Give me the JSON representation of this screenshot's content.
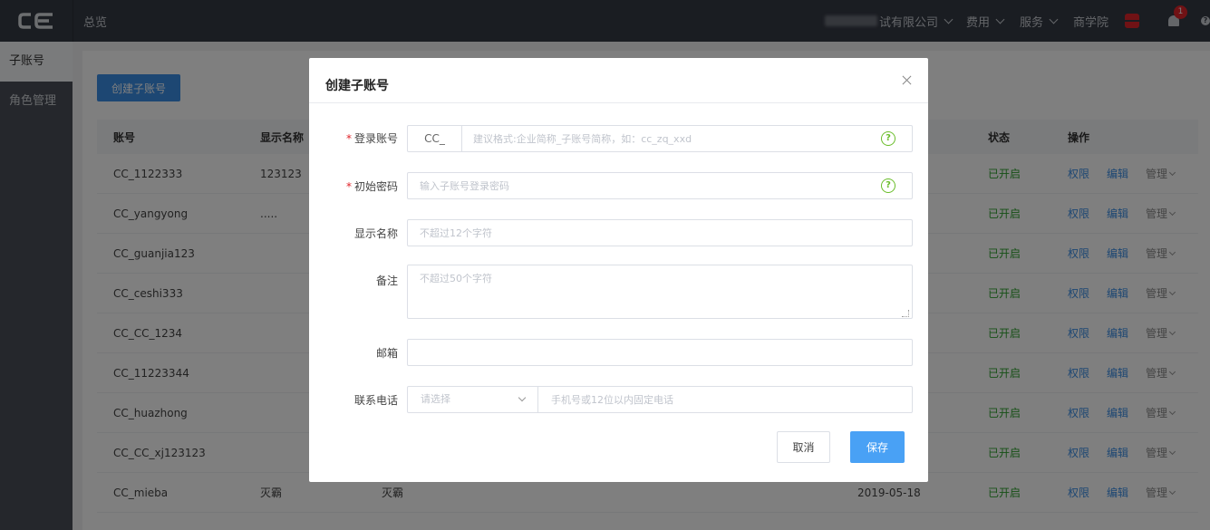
{
  "topbar": {
    "logo_text": "CE",
    "nav_overview": "总览",
    "company_suffix": "试有限公司",
    "menus": [
      {
        "label": "费用"
      },
      {
        "label": "服务"
      }
    ],
    "academy": "商学院",
    "notification_count": "1",
    "help_glyph": "?"
  },
  "sidebar": {
    "items": [
      {
        "label": "子账号"
      },
      {
        "label": "角色管理"
      }
    ]
  },
  "main": {
    "create_button": "创建子账号",
    "table": {
      "headers": {
        "account": "账号",
        "display_name": "显示名称",
        "status": "状态",
        "ops": "操作"
      },
      "rows": [
        {
          "account": "CC_1122333",
          "display_name": "123123",
          "alias": "",
          "date": "",
          "status": "已开启"
        },
        {
          "account": "CC_yangyong",
          "display_name": ".....",
          "alias": "",
          "date": "",
          "status": "已开启"
        },
        {
          "account": "CC_guanjia123",
          "display_name": "",
          "alias": "",
          "date": "",
          "status": "已开启"
        },
        {
          "account": "CC_ceshi333",
          "display_name": "",
          "alias": "",
          "date": "",
          "status": "已开启"
        },
        {
          "account": "CC_CC_1234",
          "display_name": "",
          "alias": "",
          "date": "",
          "status": "已开启"
        },
        {
          "account": "CC_11223344",
          "display_name": "",
          "alias": "",
          "date": "",
          "status": "已开启"
        },
        {
          "account": "CC_huazhong",
          "display_name": "",
          "alias": "",
          "date": "",
          "status": "已开启"
        },
        {
          "account": "CC_CC_xj123123",
          "display_name": "",
          "alias": "",
          "date": "",
          "status": "已开启"
        },
        {
          "account": "CC_mieba",
          "display_name": "灭霸",
          "alias": "灭霸",
          "date": "2019-05-18",
          "status": "已开启"
        }
      ],
      "op_permission": "权限",
      "op_edit": "编辑",
      "op_manage": "管理"
    }
  },
  "modal": {
    "title": "创建子账号",
    "fields": {
      "login_account": {
        "label": "登录账号",
        "prefix": "CC_",
        "placeholder": "建议格式:企业简称_子账号简称，如：cc_zq_xxd"
      },
      "initial_password": {
        "label": "初始密码",
        "placeholder": "输入子账号登录密码"
      },
      "display_name": {
        "label": "显示名称",
        "placeholder": "不超过12个字符"
      },
      "remark": {
        "label": "备注",
        "placeholder": "不超过50个字符"
      },
      "email": {
        "label": "邮箱",
        "placeholder": ""
      },
      "phone": {
        "label": "联系电话",
        "select_placeholder": "请选择",
        "placeholder": "手机号或12位以内固定电话"
      }
    },
    "required_mark": "*",
    "help_glyph": "?",
    "cancel_label": "取消",
    "save_label": "保存"
  },
  "colors": {
    "topbar_bg": "#353a45",
    "sidebar_bg": "#4a4f58",
    "primary": "#49a1f5",
    "status_green": "#2ea12e",
    "required_red": "#e0242a",
    "help_green": "#6abd2a"
  }
}
